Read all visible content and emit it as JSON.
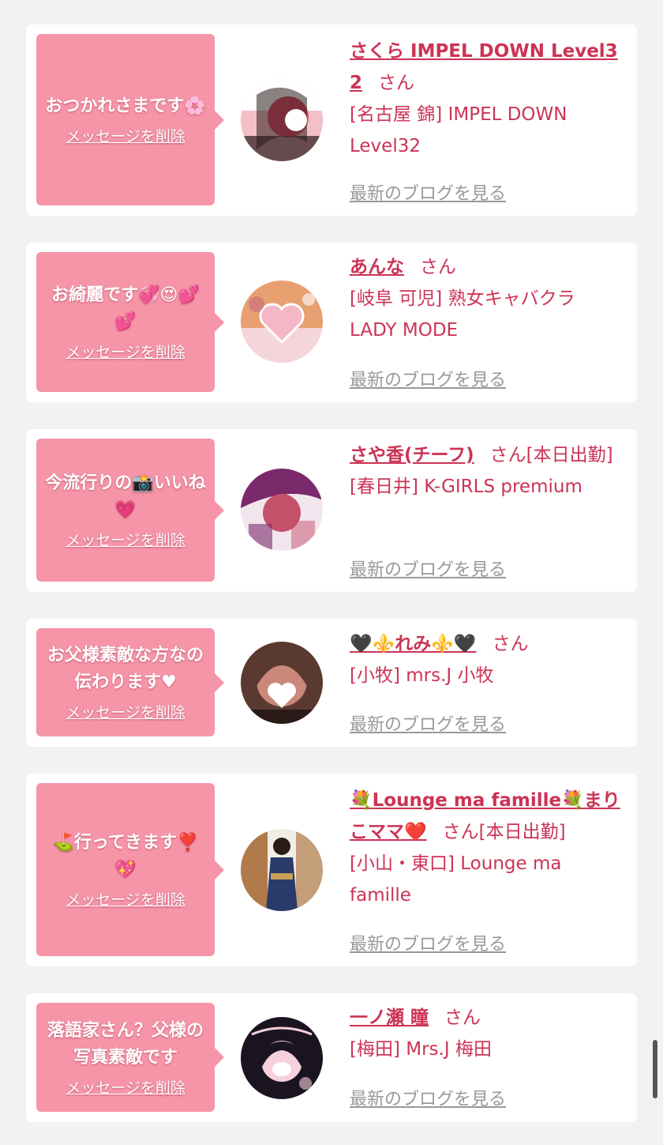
{
  "messages": [
    {
      "message": "おつかれさまです🌸",
      "delete_label": "メッセージを削除",
      "girl_name": "さくら IMPEL DOWN Level32",
      "honorific": "さん",
      "status": "",
      "shop": "[名古屋 錦] IMPEL DOWN Level32",
      "blog_label": "最新のブログを見る",
      "avatar_icon": "girl-photo-avatar-icon",
      "avatar_colors": [
        "#d9485f",
        "#2a1a1a",
        "#f4c0c8"
      ]
    },
    {
      "message": "お綺麗です💞😍💕💕",
      "delete_label": "メッセージを削除",
      "girl_name": "あんな",
      "honorific": "さん",
      "status": "",
      "shop": "[岐阜 可児] 熟女キャバクラ LADY MODE",
      "blog_label": "最新のブログを見る",
      "avatar_icon": "heart-photo-avatar-icon",
      "avatar_colors": [
        "#e8a070",
        "#f5d5dc",
        "#c06080"
      ]
    },
    {
      "message": "今流行りの📸いいね💗",
      "delete_label": "メッセージを削除",
      "girl_name": "さや香(チーフ)",
      "honorific": "さん",
      "status": "[本日出勤]",
      "shop": "[春日井] K-GIRLS premium",
      "blog_label": "最新のブログを見る",
      "avatar_icon": "girl-photo-avatar-icon",
      "avatar_colors": [
        "#7a2a6a",
        "#c4506a",
        "#f2e6ee"
      ]
    },
    {
      "message": "お父様素敵な方なの伝わります♥",
      "delete_label": "メッセージを削除",
      "girl_name": "🖤⚜️れみ⚜️🖤",
      "honorific": "さん",
      "status": "",
      "shop": "[小牧] mrs.J 小牧",
      "blog_label": "最新のブログを見る",
      "avatar_icon": "girl-photo-avatar-icon",
      "avatar_colors": [
        "#5a3a30",
        "#c9887a",
        "#ffffff"
      ]
    },
    {
      "message": "⛳️行ってきます❣️💖",
      "delete_label": "メッセージを削除",
      "girl_name": "💐Lounge ma famille💐まりこママ❤️",
      "honorific": "さん",
      "status": "[本日出勤]",
      "shop": "[小山・東口] Lounge ma famille",
      "blog_label": "最新のブログを見る",
      "avatar_icon": "kimono-photo-avatar-icon",
      "avatar_colors": [
        "#b07a4a",
        "#2a3a6a",
        "#f0ede6"
      ]
    },
    {
      "message": "落語家さん？父様の写真素敵です",
      "delete_label": "メッセージを削除",
      "girl_name": "一ノ瀬 瞳",
      "honorific": "さん",
      "status": "",
      "shop": "[梅田] Mrs.J 梅田",
      "blog_label": "最新のブログを見る",
      "avatar_icon": "girl-photo-avatar-icon",
      "avatar_colors": [
        "#1a1420",
        "#f6d0dc",
        "#ffffff"
      ]
    }
  ]
}
